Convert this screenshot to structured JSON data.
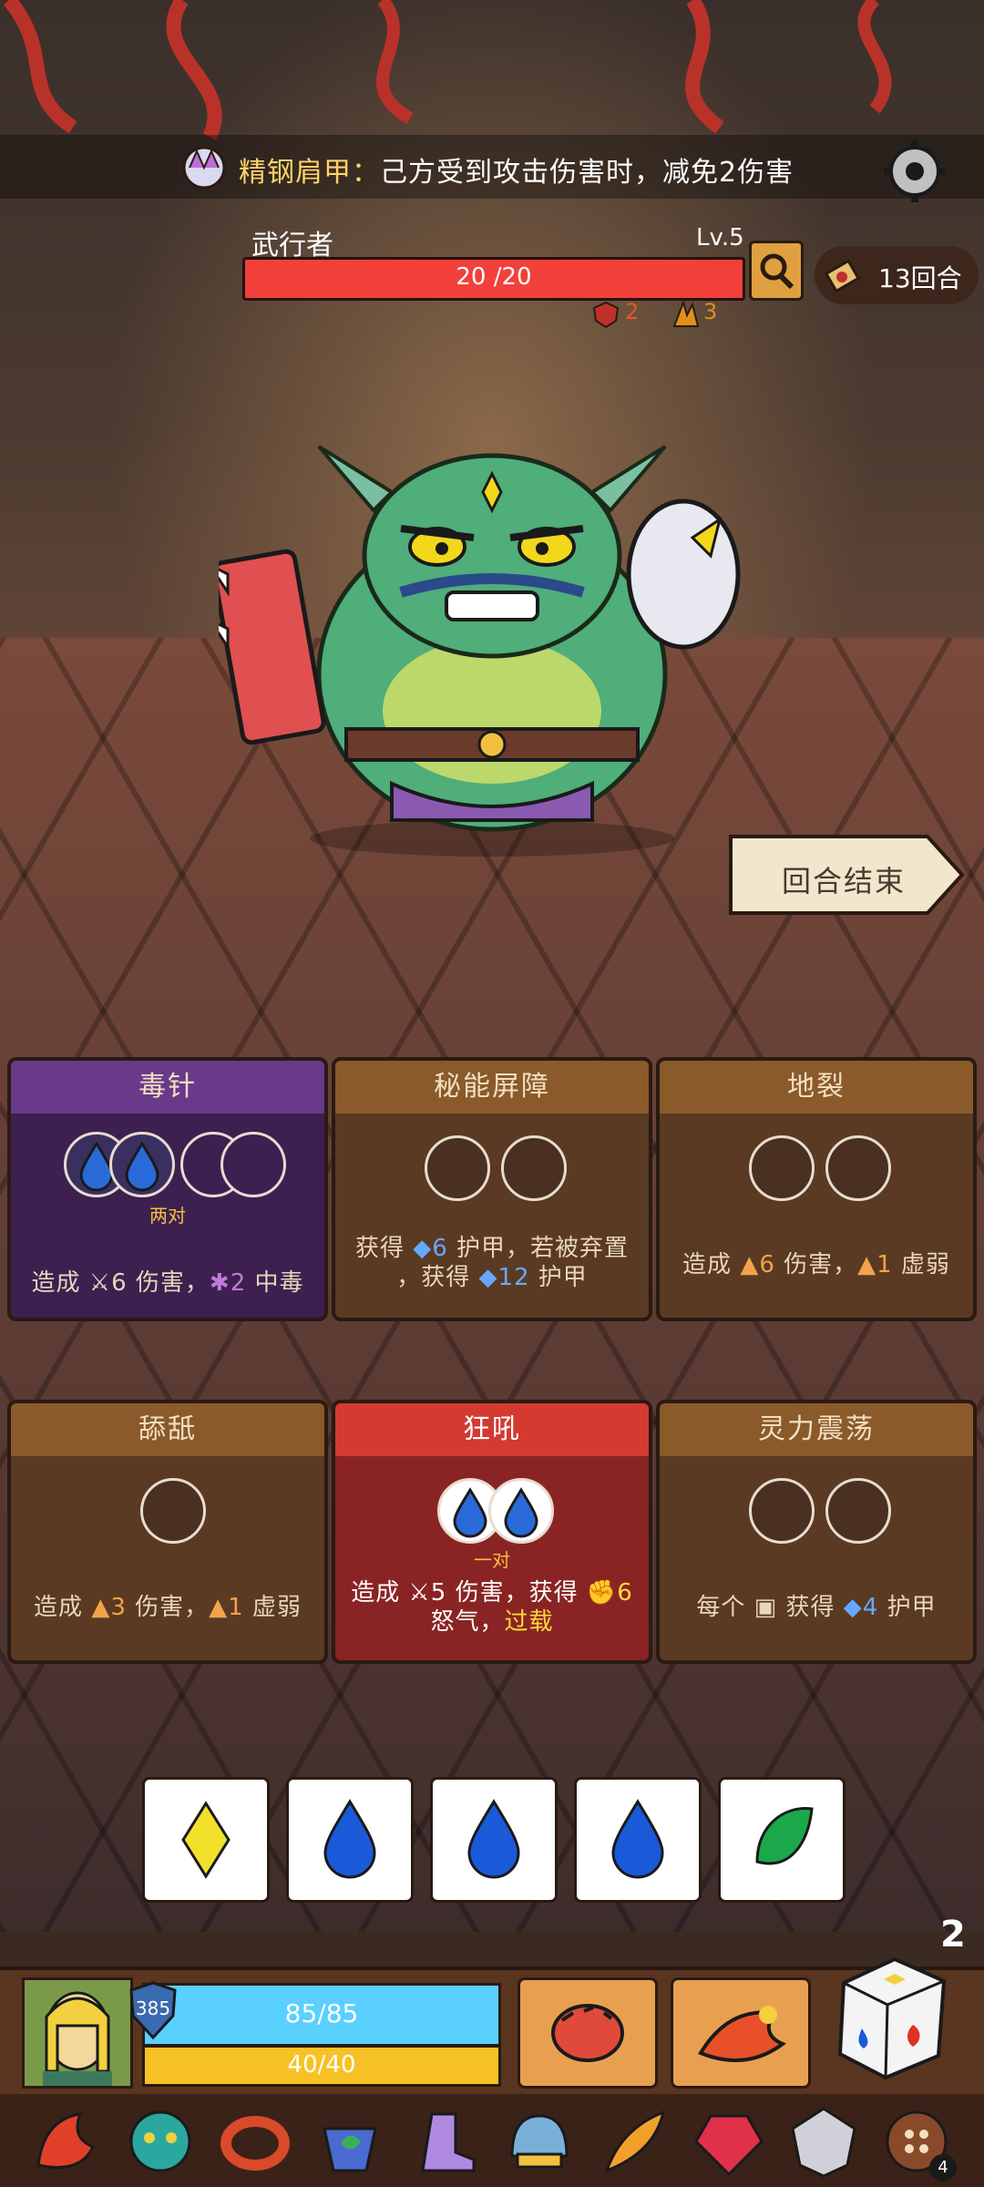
{
  "relic_banner": {
    "name": "精钢肩甲：",
    "effect": "己方受到攻击伤害时，减免2伤害"
  },
  "enemy": {
    "name": "武行者",
    "level": "Lv.5",
    "hp_text": "20 /20",
    "hp_fraction": 1.0,
    "status_1": "2",
    "status_2": "3"
  },
  "round": {
    "label": "13回合"
  },
  "end_turn": {
    "label": "回合结束"
  },
  "cards": [
    {
      "title": "毒针",
      "slot_label": "两对",
      "desc_parts": [
        "造成 ",
        "6",
        " 伤害，",
        "2",
        " 中毒"
      ]
    },
    {
      "title": "秘能屏障",
      "desc_parts": [
        "获得 ",
        "6",
        " 护甲，若被弃置",
        "，获得 ",
        "12",
        " 护甲"
      ]
    },
    {
      "title": "地裂",
      "desc_parts": [
        "造成 ",
        "6",
        " 伤害，",
        "1",
        " 虚弱"
      ]
    },
    {
      "title": "舔舐",
      "desc_parts": [
        "造成 ",
        "3",
        " 伤害，",
        "1",
        " 虚弱"
      ]
    },
    {
      "title": "狂吼",
      "slot_label": "一对",
      "desc_parts": [
        "造成 ",
        "5",
        " 伤害，获得 ",
        "6",
        "怒气，",
        "过载"
      ]
    },
    {
      "title": "灵力震荡",
      "desc_parts": [
        "每个 ",
        " 获得 ",
        "4",
        " 护甲"
      ]
    }
  ],
  "dice_tray": {
    "dice": [
      "yellow-diamond",
      "blue-drop",
      "blue-drop",
      "blue-drop",
      "green-leaf"
    ],
    "remaining_count": "2"
  },
  "player": {
    "armor": "385",
    "hp_text": "85/85",
    "rage_text": "40/40"
  },
  "relic_bar": {
    "items": [
      "fire-relic",
      "demon-mask-relic",
      "bracelet-relic",
      "leaf-cup-relic",
      "boot-relic",
      "helmet-relic",
      "feather-relic",
      "ruby-relic",
      "crystal-relic",
      "button-relic"
    ],
    "last_badge": "4"
  },
  "colors": {
    "hp_red": "#f2403a",
    "mana_blue": "#5ad0ff",
    "rage_yellow": "#f7c226",
    "card_purple": "#3d2050",
    "card_brown": "#5a3a22",
    "card_red": "#8a2424"
  }
}
